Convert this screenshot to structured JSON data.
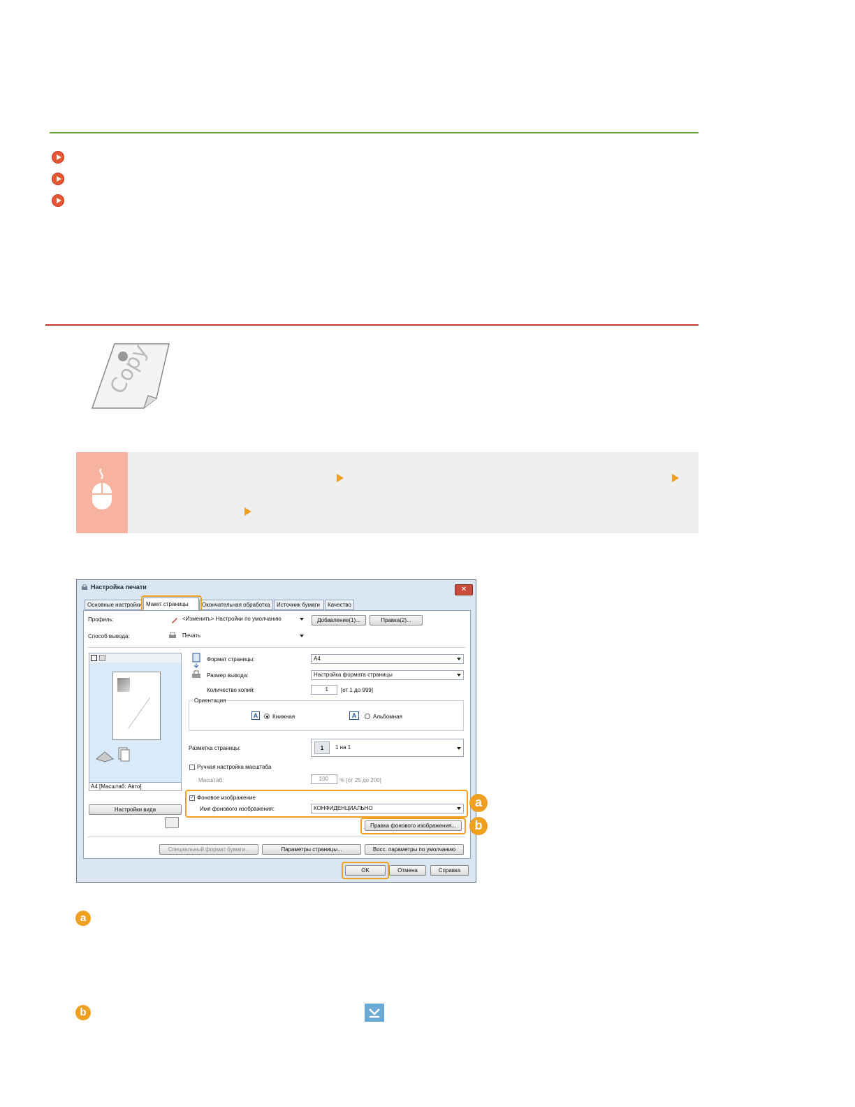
{
  "dialog": {
    "title": "Настройка печати",
    "tabs": [
      "Основные настройки",
      "Макет страницы",
      "Окончательная обработка",
      "Источник бумаги",
      "Качество"
    ],
    "profile_label": "Профиль:",
    "profile_value": "<Изменить> Настройки по умолчанию",
    "add_button": "Добавление(1)...",
    "edit_button": "Правка(2)...",
    "output_label": "Способ вывода:",
    "output_value": "Печать",
    "page_size_label": "Формат страницы:",
    "page_size_value": "A4",
    "output_size_label": "Размер вывода:",
    "output_size_value": "Настройка формата страницы",
    "copies_label": "Количество копий:",
    "copies_value": "1",
    "copies_range": "[от 1 до 999]",
    "orientation_label": "Ориентация",
    "portrait": "Книжная",
    "landscape": "Альбомная",
    "layout_label": "Разметка страницы:",
    "layout_value": "1 на 1",
    "manual_scale": "Ручная настройка масштаба",
    "scale_label": "Масштаб:",
    "scale_value": "100",
    "scale_range": "% [от 25 до 200]",
    "preview_caption": "A4 [Масштаб: Авто]",
    "view_settings": "Настройки вида",
    "watermark_label": "Фоновое изображение",
    "watermark_name_label": "Имя фонового изображения:",
    "watermark_name_value": "КОНФИДЕНЦИАЛЬНО",
    "edit_watermark": "Правка фонового изображения...",
    "custom_paper": "Специальный формат бумаги...",
    "page_options": "Параметры страницы...",
    "restore_defaults": "Восс. параметры по умолчанию",
    "ok": "OK",
    "cancel": "Отмена",
    "help": "Справка"
  },
  "illustration": {
    "copy_text": "Copy"
  },
  "callouts": [
    "a",
    "b"
  ],
  "colors": {
    "accent": "#f0a020",
    "green_rule": "#6fa83a",
    "red_rule": "#c9352b",
    "bullet": "#e4572e",
    "proc_side": "#f7b39f"
  }
}
